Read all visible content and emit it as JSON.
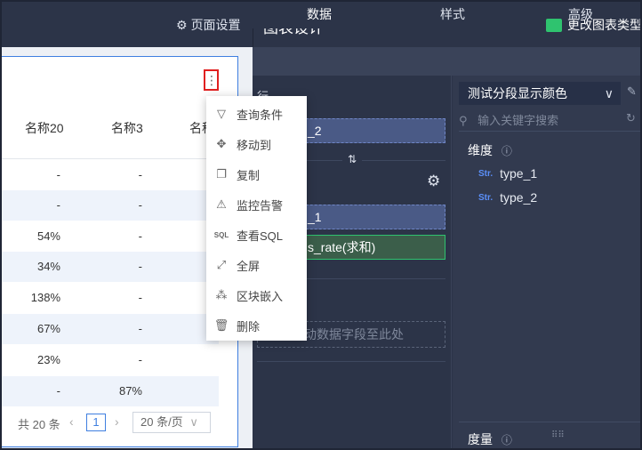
{
  "header": {
    "page_settings": "页面设置",
    "chart_design": "图表设计",
    "change_chart_type": "更改图表类型"
  },
  "table": {
    "columns": [
      "名称20",
      "名称3",
      "名称"
    ],
    "rows": [
      [
        "-",
        "-"
      ],
      [
        "-",
        "-"
      ],
      [
        "54%",
        "-"
      ],
      [
        "34%",
        "-"
      ],
      [
        "138%",
        "-"
      ],
      [
        "67%",
        "-"
      ],
      [
        "23%",
        "-"
      ],
      [
        "-",
        "87%"
      ]
    ]
  },
  "pagination": {
    "total": "共 20 条",
    "current_page": "1",
    "page_size": "20 条/页"
  },
  "menu": {
    "items": [
      {
        "label": "查询条件",
        "icon": "filter-icon"
      },
      {
        "label": "移动到",
        "icon": "move-icon"
      },
      {
        "label": "复制",
        "icon": "copy-icon"
      },
      {
        "label": "监控告警",
        "icon": "alarm-icon"
      },
      {
        "label": "查看SQL",
        "icon": "sql-icon"
      },
      {
        "label": "全屏",
        "icon": "fullscreen-icon"
      },
      {
        "label": "区块嵌入",
        "icon": "embed-icon"
      },
      {
        "label": "删除",
        "icon": "delete-icon"
      }
    ]
  },
  "tabs": [
    "数据",
    "样式",
    "高级"
  ],
  "config": {
    "row_label": "行",
    "row_field": "_2",
    "col_field1": "_1",
    "col_field2": "s_rate(求和)",
    "drop_hint": "动数据字段至此处"
  },
  "right_panel": {
    "dataset": "测试分段显示颜色",
    "search_placeholder": "输入关键字搜索",
    "dimension_title": "维度",
    "fields": [
      {
        "type": "Str.",
        "name": "type_1"
      },
      {
        "type": "Str.",
        "name": "type_2"
      }
    ],
    "measure_title": "度量"
  },
  "colors": {
    "accent": "#3f7fe0",
    "panel": "#2c3448",
    "highlight_border": "#e02020",
    "green_field": "#2fc36f"
  }
}
